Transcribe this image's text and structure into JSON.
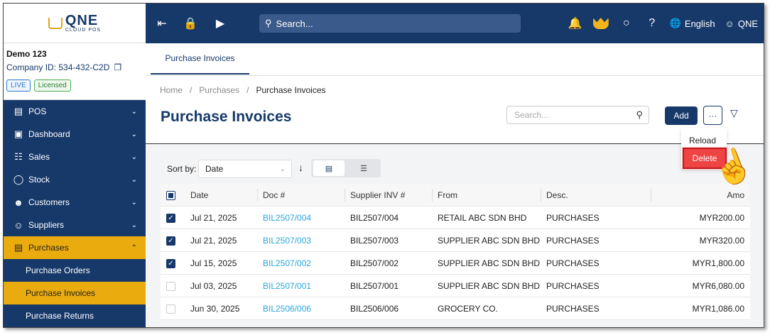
{
  "topbar": {
    "search_placeholder": "Search...",
    "language": "English",
    "user": "QNE"
  },
  "logo": {
    "main": "QNE",
    "sub": "CLOUD POS"
  },
  "company": {
    "name": "Demo 123",
    "id": "Company ID: 534-432-C2D",
    "badge_live": "LIVE",
    "badge_licensed": "Licensed"
  },
  "sidebar": {
    "items": [
      {
        "label": "POS",
        "icon": "pos-icon"
      },
      {
        "label": "Dashboard",
        "icon": "dashboard-icon"
      },
      {
        "label": "Sales",
        "icon": "sales-icon"
      },
      {
        "label": "Stock",
        "icon": "stock-icon"
      },
      {
        "label": "Customers",
        "icon": "customers-icon"
      },
      {
        "label": "Suppliers",
        "icon": "suppliers-icon"
      },
      {
        "label": "Purchases",
        "icon": "purchases-icon"
      }
    ],
    "sub_items": [
      {
        "label": "Purchase Orders"
      },
      {
        "label": "Purchase Invoices"
      },
      {
        "label": "Purchase Returns"
      }
    ]
  },
  "tabs": {
    "active": "Purchase Invoices"
  },
  "breadcrumb": {
    "home": "Home",
    "section": "Purchases",
    "current": "Purchase Invoices",
    "sep": "/"
  },
  "page": {
    "title": "Purchase Invoices",
    "search_placeholder": "Search...",
    "add_label": "Add",
    "more_label": "···"
  },
  "menu": {
    "reload": "Reload",
    "delete": "Delete"
  },
  "sort": {
    "label": "Sort by:",
    "value": "Date"
  },
  "table": {
    "headers": {
      "date": "Date",
      "doc": "Doc #",
      "supplier_inv": "Supplier INV #",
      "from": "From",
      "desc": "Desc.",
      "amount": "Amo"
    },
    "rows": [
      {
        "checked": true,
        "date": "Jul 21, 2025",
        "doc": "BIL2507/004",
        "supplier_inv": "BIL2507/004",
        "from": "RETAIL ABC SDN BHD",
        "desc": "PURCHASES",
        "amount": "MYR200.00"
      },
      {
        "checked": true,
        "date": "Jul 21, 2025",
        "doc": "BIL2507/003",
        "supplier_inv": "BIL2507/003",
        "from": "SUPPLIER ABC SDN BHD",
        "desc": "PURCHASES",
        "amount": "MYR320.00"
      },
      {
        "checked": true,
        "date": "Jul 15, 2025",
        "doc": "BIL2507/002",
        "supplier_inv": "BIL2507/002",
        "from": "SUPPLIER ABC SDN BHD",
        "desc": "PURCHASES",
        "amount": "MYR1,800.00"
      },
      {
        "checked": false,
        "date": "Jul 03, 2025",
        "doc": "BIL2507/001",
        "supplier_inv": "BIL2507/001",
        "from": "SUPPLIER ABC SDN BHD",
        "desc": "PURCHASES",
        "amount": "MYR6,080.00"
      },
      {
        "checked": false,
        "date": "Jun 30, 2025",
        "doc": "BIL2506/006",
        "supplier_inv": "BIL2506/006",
        "from": "GROCERY CO.",
        "desc": "PURCHASES",
        "amount": "MYR1,086.00"
      }
    ]
  },
  "colors": {
    "brand": "#17396a",
    "accent": "#e9ab0d",
    "link": "#2aa6dc",
    "danger": "#ef4444"
  }
}
